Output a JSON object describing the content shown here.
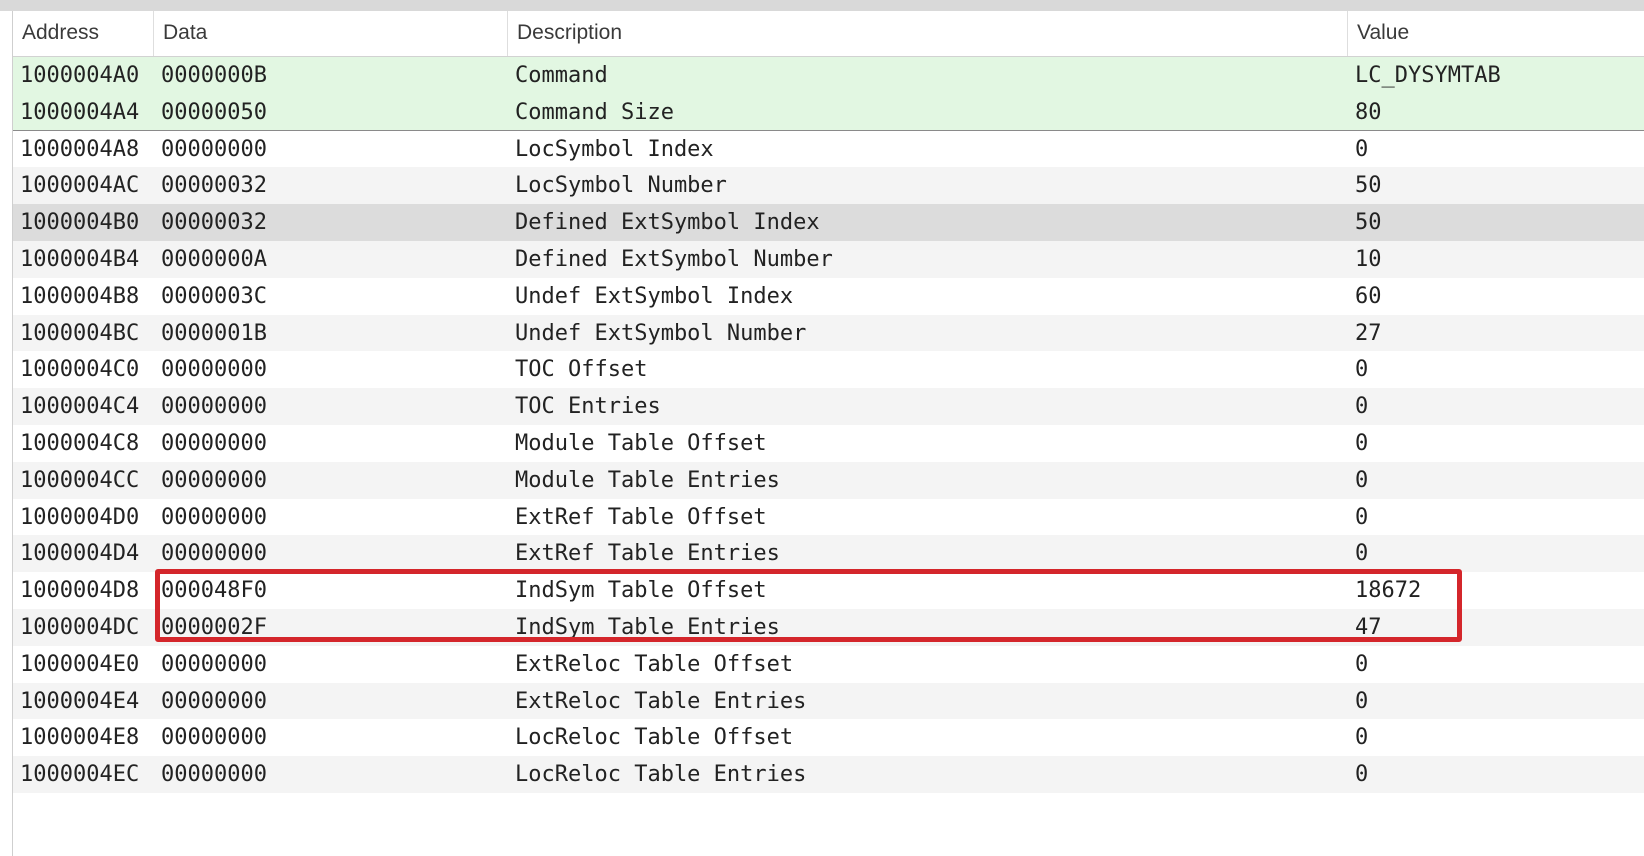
{
  "columns": {
    "address": "Address",
    "data": "Data",
    "description": "Description",
    "value": "Value"
  },
  "rows": [
    {
      "address": "1000004A0",
      "data": "0000000B",
      "description": "Command",
      "value": "LC_DYSYMTAB"
    },
    {
      "address": "1000004A4",
      "data": "00000050",
      "description": "Command Size",
      "value": "80"
    },
    {
      "address": "1000004A8",
      "data": "00000000",
      "description": "LocSymbol Index",
      "value": "0"
    },
    {
      "address": "1000004AC",
      "data": "00000032",
      "description": "LocSymbol Number",
      "value": "50"
    },
    {
      "address": "1000004B0",
      "data": "00000032",
      "description": "Defined ExtSymbol Index",
      "value": "50"
    },
    {
      "address": "1000004B4",
      "data": "0000000A",
      "description": "Defined ExtSymbol Number",
      "value": "10"
    },
    {
      "address": "1000004B8",
      "data": "0000003C",
      "description": "Undef ExtSymbol Index",
      "value": "60"
    },
    {
      "address": "1000004BC",
      "data": "0000001B",
      "description": "Undef ExtSymbol Number",
      "value": "27"
    },
    {
      "address": "1000004C0",
      "data": "00000000",
      "description": "TOC Offset",
      "value": "0"
    },
    {
      "address": "1000004C4",
      "data": "00000000",
      "description": "TOC Entries",
      "value": "0"
    },
    {
      "address": "1000004C8",
      "data": "00000000",
      "description": "Module Table Offset",
      "value": "0"
    },
    {
      "address": "1000004CC",
      "data": "00000000",
      "description": "Module Table Entries",
      "value": "0"
    },
    {
      "address": "1000004D0",
      "data": "00000000",
      "description": "ExtRef Table Offset",
      "value": "0"
    },
    {
      "address": "1000004D4",
      "data": "00000000",
      "description": "ExtRef Table Entries",
      "value": "0"
    },
    {
      "address": "1000004D8",
      "data": "000048F0",
      "description": "IndSym Table Offset",
      "value": "18672"
    },
    {
      "address": "1000004DC",
      "data": "0000002F",
      "description": "IndSym Table Entries",
      "value": "47"
    },
    {
      "address": "1000004E0",
      "data": "00000000",
      "description": "ExtReloc Table Offset",
      "value": "0"
    },
    {
      "address": "1000004E4",
      "data": "00000000",
      "description": "ExtReloc Table Entries",
      "value": "0"
    },
    {
      "address": "1000004E8",
      "data": "00000000",
      "description": "LocReloc Table Offset",
      "value": "0"
    },
    {
      "address": "1000004EC",
      "data": "00000000",
      "description": "LocReloc Table Entries",
      "value": "0"
    }
  ],
  "colors": {
    "command_highlight": "#e2f7e2",
    "selected_row": "#dcdcdc",
    "annotation_box": "#d4262b"
  }
}
